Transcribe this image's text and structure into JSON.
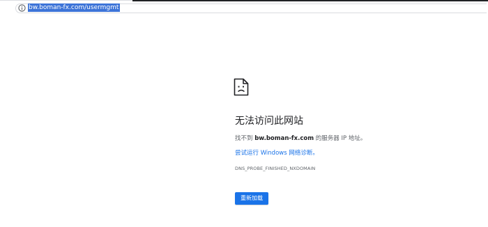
{
  "address_bar": {
    "icon": "info-icon",
    "url": "bw.boman-fx.com/usermgmt"
  },
  "error": {
    "icon": "sad-page-icon",
    "title": "无法访问此网站",
    "description_prefix": "找不到 ",
    "description_host": "bw.boman-fx.com",
    "description_suffix": " 的服务器 IP 地址。",
    "suggestion": "尝试运行 Windows 网络诊断。",
    "error_code": "DNS_PROBE_FINISHED_NXDOMAIN",
    "reload_button": "重新加载"
  },
  "colors": {
    "accent": "#1a73e8",
    "url_selection": "#3d74d8"
  }
}
